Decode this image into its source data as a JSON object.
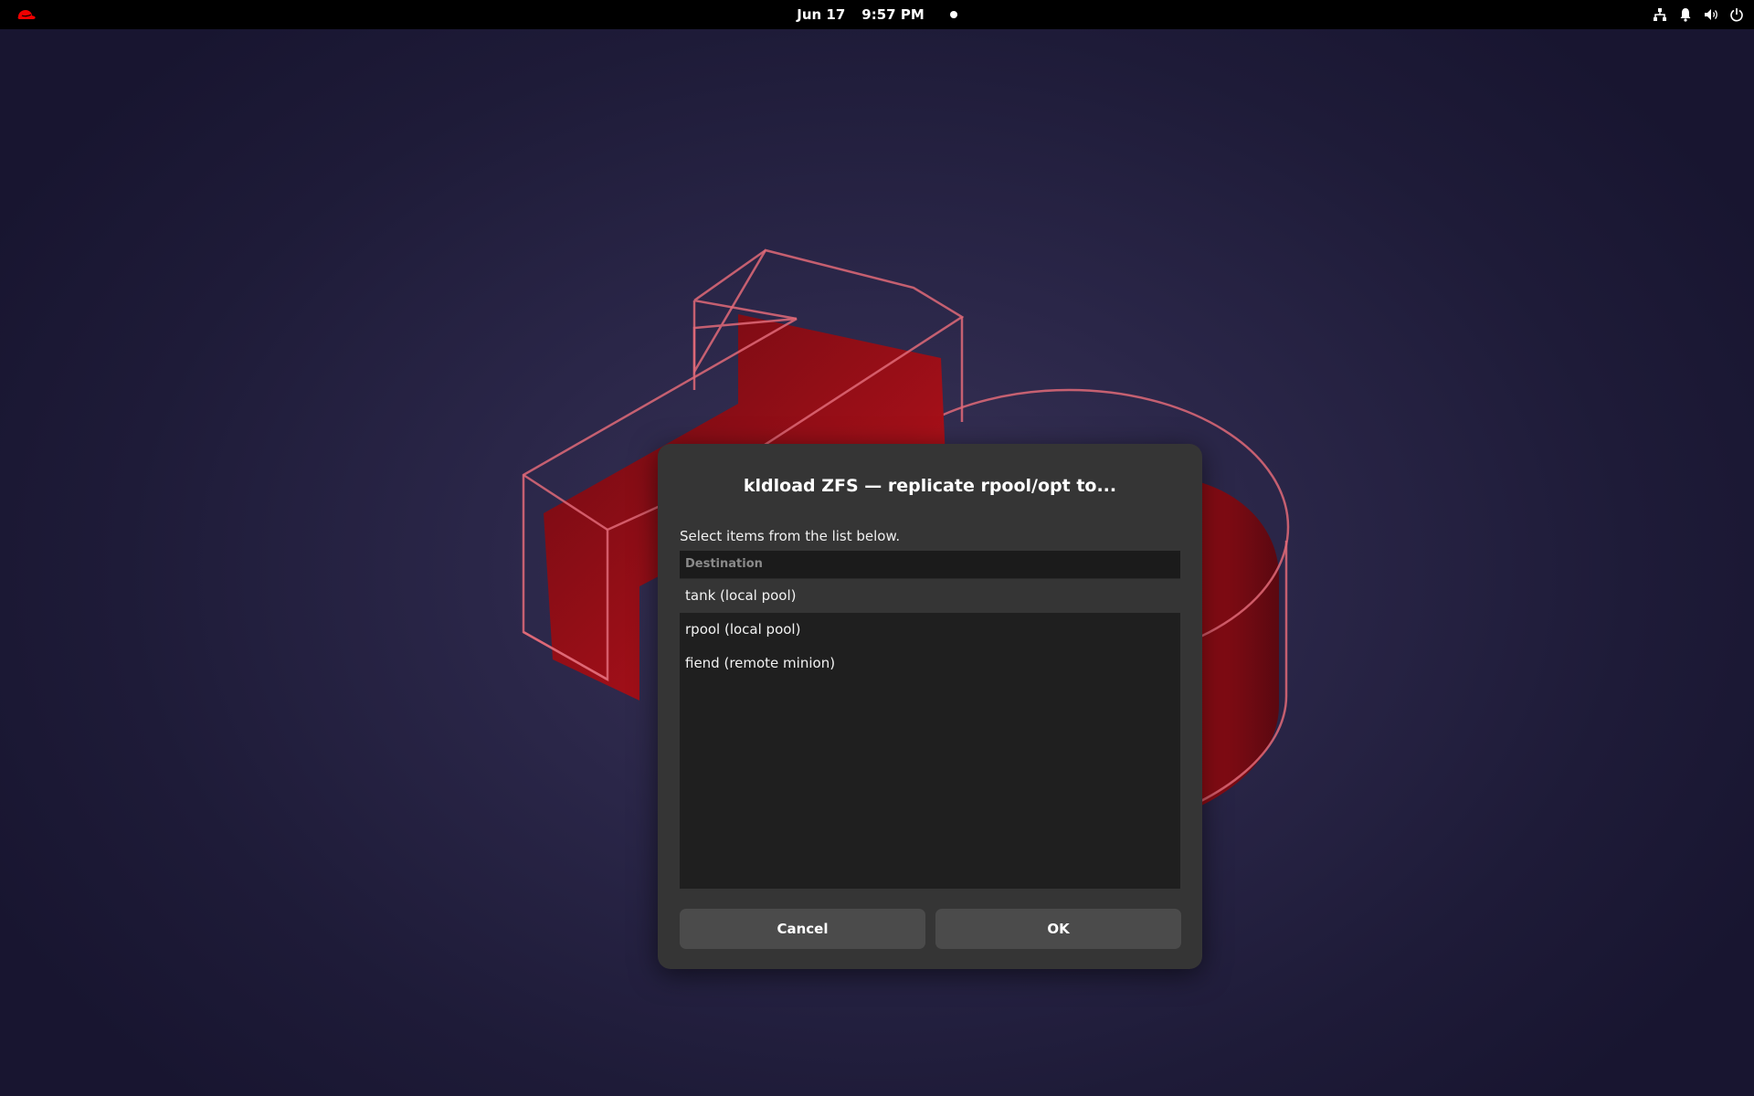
{
  "topbar": {
    "date": "Jun 17",
    "time": "9:57 PM",
    "icons": [
      "redhat-logo-icon",
      "network-icon",
      "notification-icon",
      "volume-icon",
      "power-icon"
    ]
  },
  "dialog": {
    "title": "kldload ZFS — replicate rpool/opt to...",
    "text": "Select items from the list below.",
    "column_header": "Destination",
    "items": [
      {
        "label": "tank (local pool)",
        "selected": true
      },
      {
        "label": "rpool (local pool)",
        "selected": false
      },
      {
        "label": "fiend (remote minion)",
        "selected": false
      }
    ],
    "cancel_label": "Cancel",
    "ok_label": "OK"
  },
  "colors": {
    "accent_red": "#d4161c",
    "dialog_bg": "#353535",
    "list_bg": "#1f1f1f",
    "button_bg": "#4b4b4b"
  }
}
